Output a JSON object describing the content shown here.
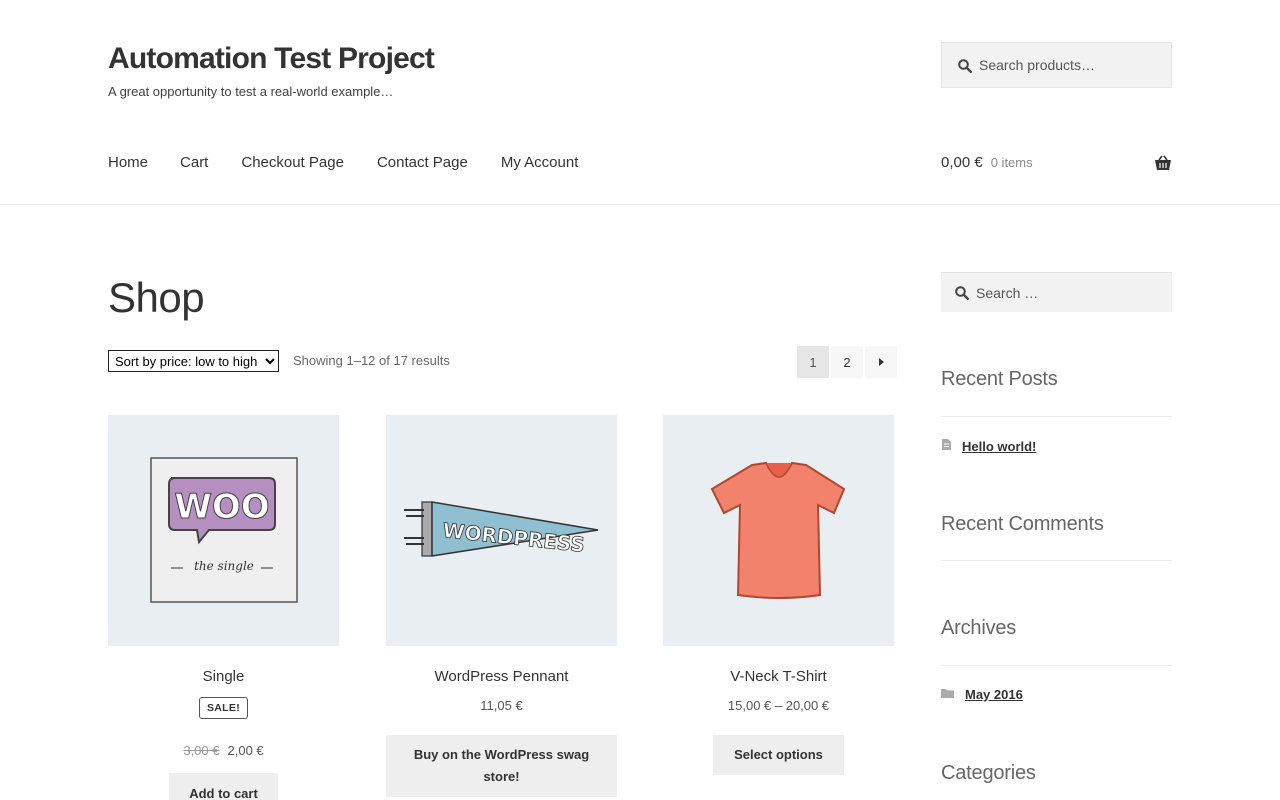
{
  "site": {
    "title": "Automation Test Project",
    "tagline": "A great opportunity to test a real-world example…"
  },
  "header_search": {
    "placeholder": "Search products…"
  },
  "nav": [
    "Home",
    "Cart",
    "Checkout Page",
    "Contact Page",
    "My Account"
  ],
  "cart": {
    "amount": "0,00 €",
    "count": "0 items"
  },
  "page": {
    "title": "Shop"
  },
  "sort": {
    "selected": "Sort by price: low to high"
  },
  "results": "Showing 1–12 of 17 results",
  "pagination": {
    "current": "1",
    "next": "2"
  },
  "products": [
    {
      "name": "Single",
      "badge": "SALE!",
      "old_price": "3,00 €",
      "price": "2,00 €",
      "button": "Add to cart"
    },
    {
      "name": "WordPress Pennant",
      "price": "11,05 €",
      "button": "Buy on the WordPress swag store!"
    },
    {
      "name": "V-Neck T-Shirt",
      "price": "15,00 € – 20,00 €",
      "button": "Select options"
    }
  ],
  "sidebar": {
    "search_placeholder": "Search …",
    "recent_posts_title": "Recent Posts",
    "recent_post_1": "Hello world!",
    "recent_comments_title": "Recent Comments",
    "archives_title": "Archives",
    "archive_1": "May 2016",
    "categories_title": "Categories"
  },
  "image_text": {
    "woo": "WOO",
    "the_single": "the single",
    "pennant": "WORDPRESS"
  }
}
